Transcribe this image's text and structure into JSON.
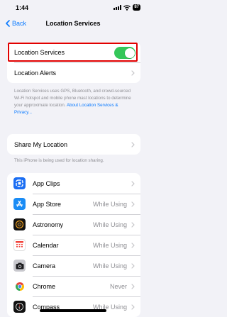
{
  "status_bar": {
    "time": "1:44",
    "battery": "87",
    "icons": [
      "signal-icon",
      "wifi-icon",
      "battery-icon"
    ]
  },
  "nav": {
    "back_label": "Back",
    "title": "Location Services"
  },
  "location_services": {
    "label": "Location Services",
    "toggle_on": true
  },
  "location_alerts": {
    "label": "Location Alerts"
  },
  "description": {
    "text": "Location Services uses GPS, Bluetooth, and crowd-sourced Wi-Fi hotspot and mobile phone mast locations to determine your approximate location.",
    "link": "About Location Services & Privacy..."
  },
  "share_location": {
    "label": "Share My Location",
    "note": "This iPhone is being used for location sharing."
  },
  "apps": [
    {
      "name": "App Clips",
      "value": "",
      "icon": "app-clips-icon"
    },
    {
      "name": "App Store",
      "value": "While Using",
      "icon": "app-store-icon"
    },
    {
      "name": "Astronomy",
      "value": "While Using",
      "icon": "astronomy-icon"
    },
    {
      "name": "Calendar",
      "value": "While Using",
      "icon": "calendar-icon"
    },
    {
      "name": "Camera",
      "value": "While Using",
      "icon": "camera-icon"
    },
    {
      "name": "Chrome",
      "value": "Never",
      "icon": "chrome-icon"
    },
    {
      "name": "Compass",
      "value": "While Using",
      "icon": "compass-icon"
    }
  ],
  "colors": {
    "accent": "#0a7aff",
    "toggle_on": "#34c759",
    "highlight": "#e00000",
    "background": "#f2f2f7"
  }
}
